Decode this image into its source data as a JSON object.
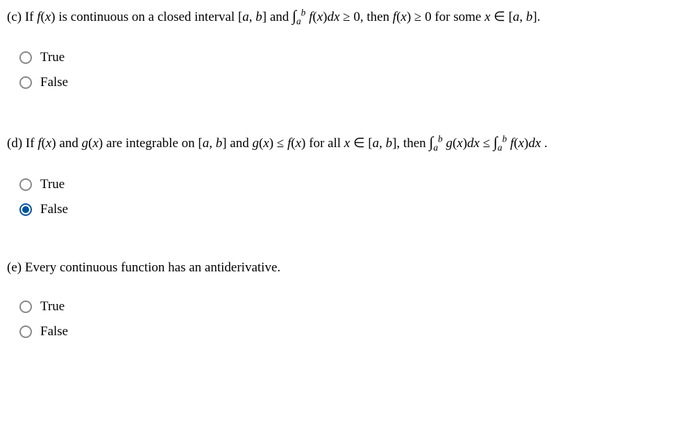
{
  "questions": [
    {
      "label": "(c)",
      "prefix": "If ",
      "body_html": true,
      "text": "f(x) is continuous on a closed interval [a, b] and ∫ₐᵇ f(x)dx ≥ 0, then f(x) ≥ 0 for some x ∈ [a, b].",
      "options": {
        "true": "True",
        "false": "False"
      },
      "selected": null
    },
    {
      "label": "(d)",
      "prefix": "If ",
      "text": "f(x) and g(x) are integrable on [a, b] and g(x) ≤ f(x) for all x ∈ [a, b], then ∫ₐᵇ g(x)dx ≤ ∫ₐᵇ f(x)dx .",
      "options": {
        "true": "True",
        "false": "False"
      },
      "selected": "false"
    },
    {
      "label": "(e)",
      "prefix": "",
      "text": "Every continuous function has an antiderivative.",
      "options": {
        "true": "True",
        "false": "False"
      },
      "selected": null
    }
  ]
}
